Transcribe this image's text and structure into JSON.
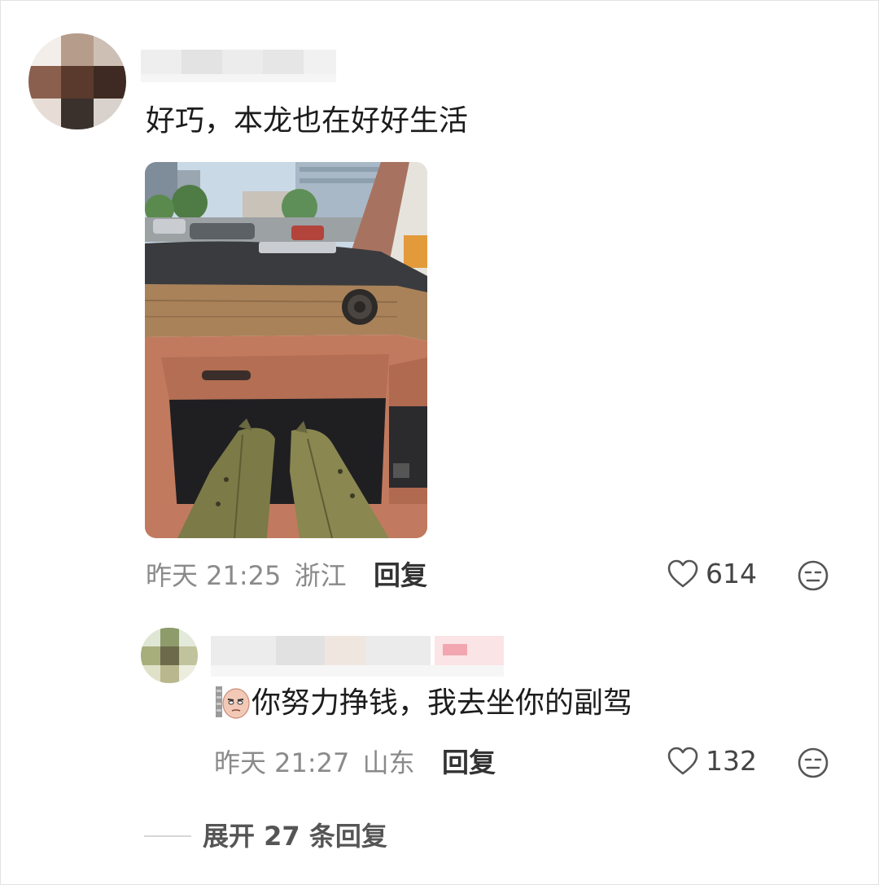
{
  "comment": {
    "text": "好巧，本龙也在好好生活",
    "time": "昨天 21:25",
    "location": "浙江",
    "reply_label": "回复",
    "likes": "614"
  },
  "reply": {
    "text": "你努力挣钱，我去坐你的副驾",
    "time": "昨天 21:27",
    "location": "山东",
    "reply_label": "回复",
    "likes": "132"
  },
  "expand": {
    "label": "展开 27 条回复"
  },
  "colors": {
    "meta": "#8a8a8a",
    "reply_button": "#333333",
    "interior_leather": "#c27a5e",
    "wood_trim": "#a9825a"
  },
  "icons": {
    "like": "heart-outline-icon",
    "dislike": "unhappy-face-icon",
    "sticker": "face-emoji-icon"
  }
}
